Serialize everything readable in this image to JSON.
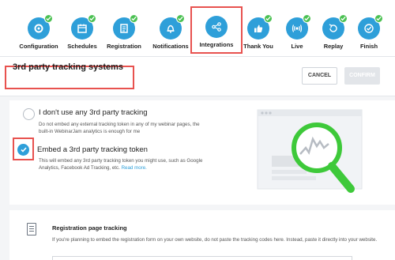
{
  "steps": [
    {
      "label": "Configuration",
      "icon": "gear-icon",
      "done": true
    },
    {
      "label": "Schedules",
      "icon": "calendar-icon",
      "done": true
    },
    {
      "label": "Registration",
      "icon": "form-icon",
      "done": true
    },
    {
      "label": "Notifications",
      "icon": "bell-icon",
      "done": true
    },
    {
      "label": "Integrations",
      "icon": "share-icon",
      "done": false,
      "active": true
    },
    {
      "label": "Thank You",
      "icon": "thumbs-up-icon",
      "done": true
    },
    {
      "label": "Live",
      "icon": "broadcast-icon",
      "done": true
    },
    {
      "label": "Replay",
      "icon": "replay-icon",
      "done": true
    },
    {
      "label": "Finish",
      "icon": "check-circle-icon",
      "done": true
    }
  ],
  "header": {
    "title": "3rd party tracking systems",
    "cancel_label": "CANCEL",
    "confirm_label": "CONFIRM"
  },
  "options": [
    {
      "title": "I don't use any 3rd party tracking",
      "description": "Do not embed any external tracking token in any of my webinar pages, the built-in WebinarJam analytics is enough for me",
      "selected": false
    },
    {
      "title": "Embed a 3rd party tracking token",
      "description": "This will embed any 3rd party tracking token you might use, such as Google Analytics, Facebook Ad Tracking, etc.",
      "link": "Read more.",
      "selected": true
    }
  ],
  "registration": {
    "title": "Registration page tracking",
    "description": "If you're planning to embed the registration form on your own website, do not paste the tracking codes here. Instead, paste it directly into your website."
  },
  "colors": {
    "accent": "#2e9fd9",
    "done": "#4cc153",
    "highlight": "#e8524f",
    "magnifier": "#3ec93a"
  }
}
